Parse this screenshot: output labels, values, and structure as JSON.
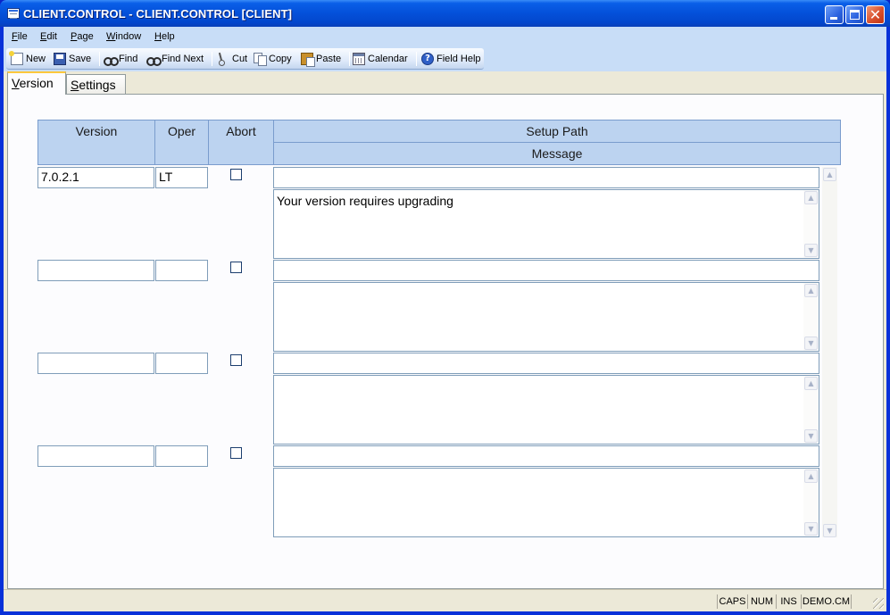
{
  "window": {
    "title": "CLIENT.CONTROL - CLIENT.CONTROL [CLIENT]"
  },
  "menu": [
    {
      "label": "File",
      "key": "F",
      "rest": "ile"
    },
    {
      "label": "Edit",
      "key": "E",
      "rest": "dit"
    },
    {
      "label": "Page",
      "key": "P",
      "rest": "age"
    },
    {
      "label": "Window",
      "key": "W",
      "rest": "indow"
    },
    {
      "label": "Help",
      "key": "H",
      "rest": "elp"
    }
  ],
  "toolbar": {
    "new": "New",
    "save": "Save",
    "find": "Find",
    "find_next": "Find Next",
    "cut": "Cut",
    "copy": "Copy",
    "paste": "Paste",
    "calendar": "Calendar",
    "field_help": "Field Help"
  },
  "tabs": {
    "version": {
      "key": "V",
      "rest": "ersion"
    },
    "settings": {
      "key": "S",
      "rest": "ettings"
    }
  },
  "grid": {
    "headers": {
      "version": "Version",
      "oper": "Oper",
      "abort": "Abort",
      "setup_path": "Setup Path",
      "message": "Message"
    },
    "rows": [
      {
        "version": "7.0.2.1",
        "oper": "LT",
        "abort": false,
        "setup_path": "",
        "message": "Your version requires upgrading"
      },
      {
        "version": "",
        "oper": "",
        "abort": false,
        "setup_path": "",
        "message": ""
      },
      {
        "version": "",
        "oper": "",
        "abort": false,
        "setup_path": "",
        "message": ""
      },
      {
        "version": "",
        "oper": "",
        "abort": false,
        "setup_path": "",
        "message": ""
      }
    ]
  },
  "status": {
    "caps": "CAPS",
    "num": "NUM",
    "ins": "INS",
    "account": "DEMO.CM"
  }
}
